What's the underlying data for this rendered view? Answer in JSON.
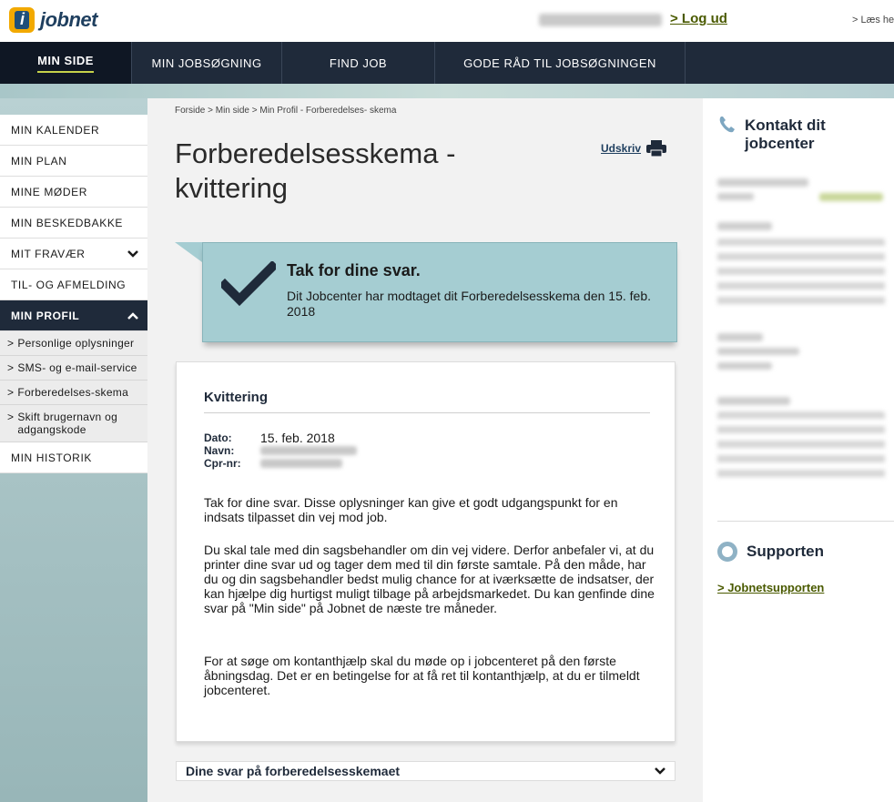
{
  "header": {
    "logo_text": "jobnet",
    "logout": "> Log ud",
    "read_more": "> Læs he"
  },
  "nav": {
    "items": [
      {
        "label": "MIN SIDE"
      },
      {
        "label": "MIN JOBSØGNING"
      },
      {
        "label": "FIND JOB"
      },
      {
        "label": "GODE RÅD TIL JOBSØGNINGEN"
      }
    ]
  },
  "sidebar": {
    "items": [
      {
        "label": "MIN KALENDER"
      },
      {
        "label": "MIN PLAN"
      },
      {
        "label": "MINE MØDER"
      },
      {
        "label": "MIN BESKEDBAKKE"
      },
      {
        "label": "MIT FRAVÆR"
      },
      {
        "label": "TIL- OG AFMELDING"
      },
      {
        "label": "MIN PROFIL"
      },
      {
        "label": "MIN HISTORIK"
      }
    ],
    "sub_items": [
      {
        "label": "Personlige oplysninger"
      },
      {
        "label": "SMS- og e-mail-service"
      },
      {
        "label": "Forberedelses-skema"
      },
      {
        "label": "Skift brugernavn og adgangskode"
      }
    ]
  },
  "main": {
    "breadcrumb": "Forside > Min side > Min Profil - Forberedelses- skema",
    "title": "Forberedelsesskema - kvittering",
    "print_label": "Udskriv",
    "ack": {
      "title": "Tak for dine svar.",
      "text": "Dit Jobcenter har modtaget dit Forberedelsesskema den 15. feb. 2018"
    },
    "receipt": {
      "title": "Kvittering",
      "date_label": "Dato:",
      "date_value": "15. feb. 2018",
      "name_label": "Navn:",
      "cpr_label": "Cpr-nr:",
      "paragraphs": [
        "Tak for dine svar. Disse oplysninger kan give et godt udgangspunkt for en indsats tilpasset din vej mod job.",
        "Du skal tale med din sagsbehandler om din vej videre. Derfor anbefaler vi, at du printer dine svar ud og tager dem med til din første samtale. På den måde, har du og din sagsbehandler bedst mulig chance for at iværksætte de indsatser, der kan hjælpe dig hurtigst muligt tilbage på arbejdsmarkedet. Du kan genfinde dine svar på \"Min side\" på Jobnet de næste tre måneder.",
        "For at søge om kontanthjælp skal du møde op i jobcenteret på den første åbningsdag. Det er en betingelse for at få ret til kontanthjælp, at du er tilmeldt jobcenteret."
      ]
    },
    "accordion_label": "Dine svar på forberedelsesskemaet"
  },
  "right": {
    "contact_title": "Kontakt dit jobcenter",
    "support_title": "Supporten",
    "support_link": "> Jobnetsupporten"
  },
  "colors": {
    "nav_bg": "#1f2a3a",
    "accent_link": "#4a5a00",
    "ack_bg": "#a5cdd2",
    "logo_orange": "#f2a900"
  }
}
